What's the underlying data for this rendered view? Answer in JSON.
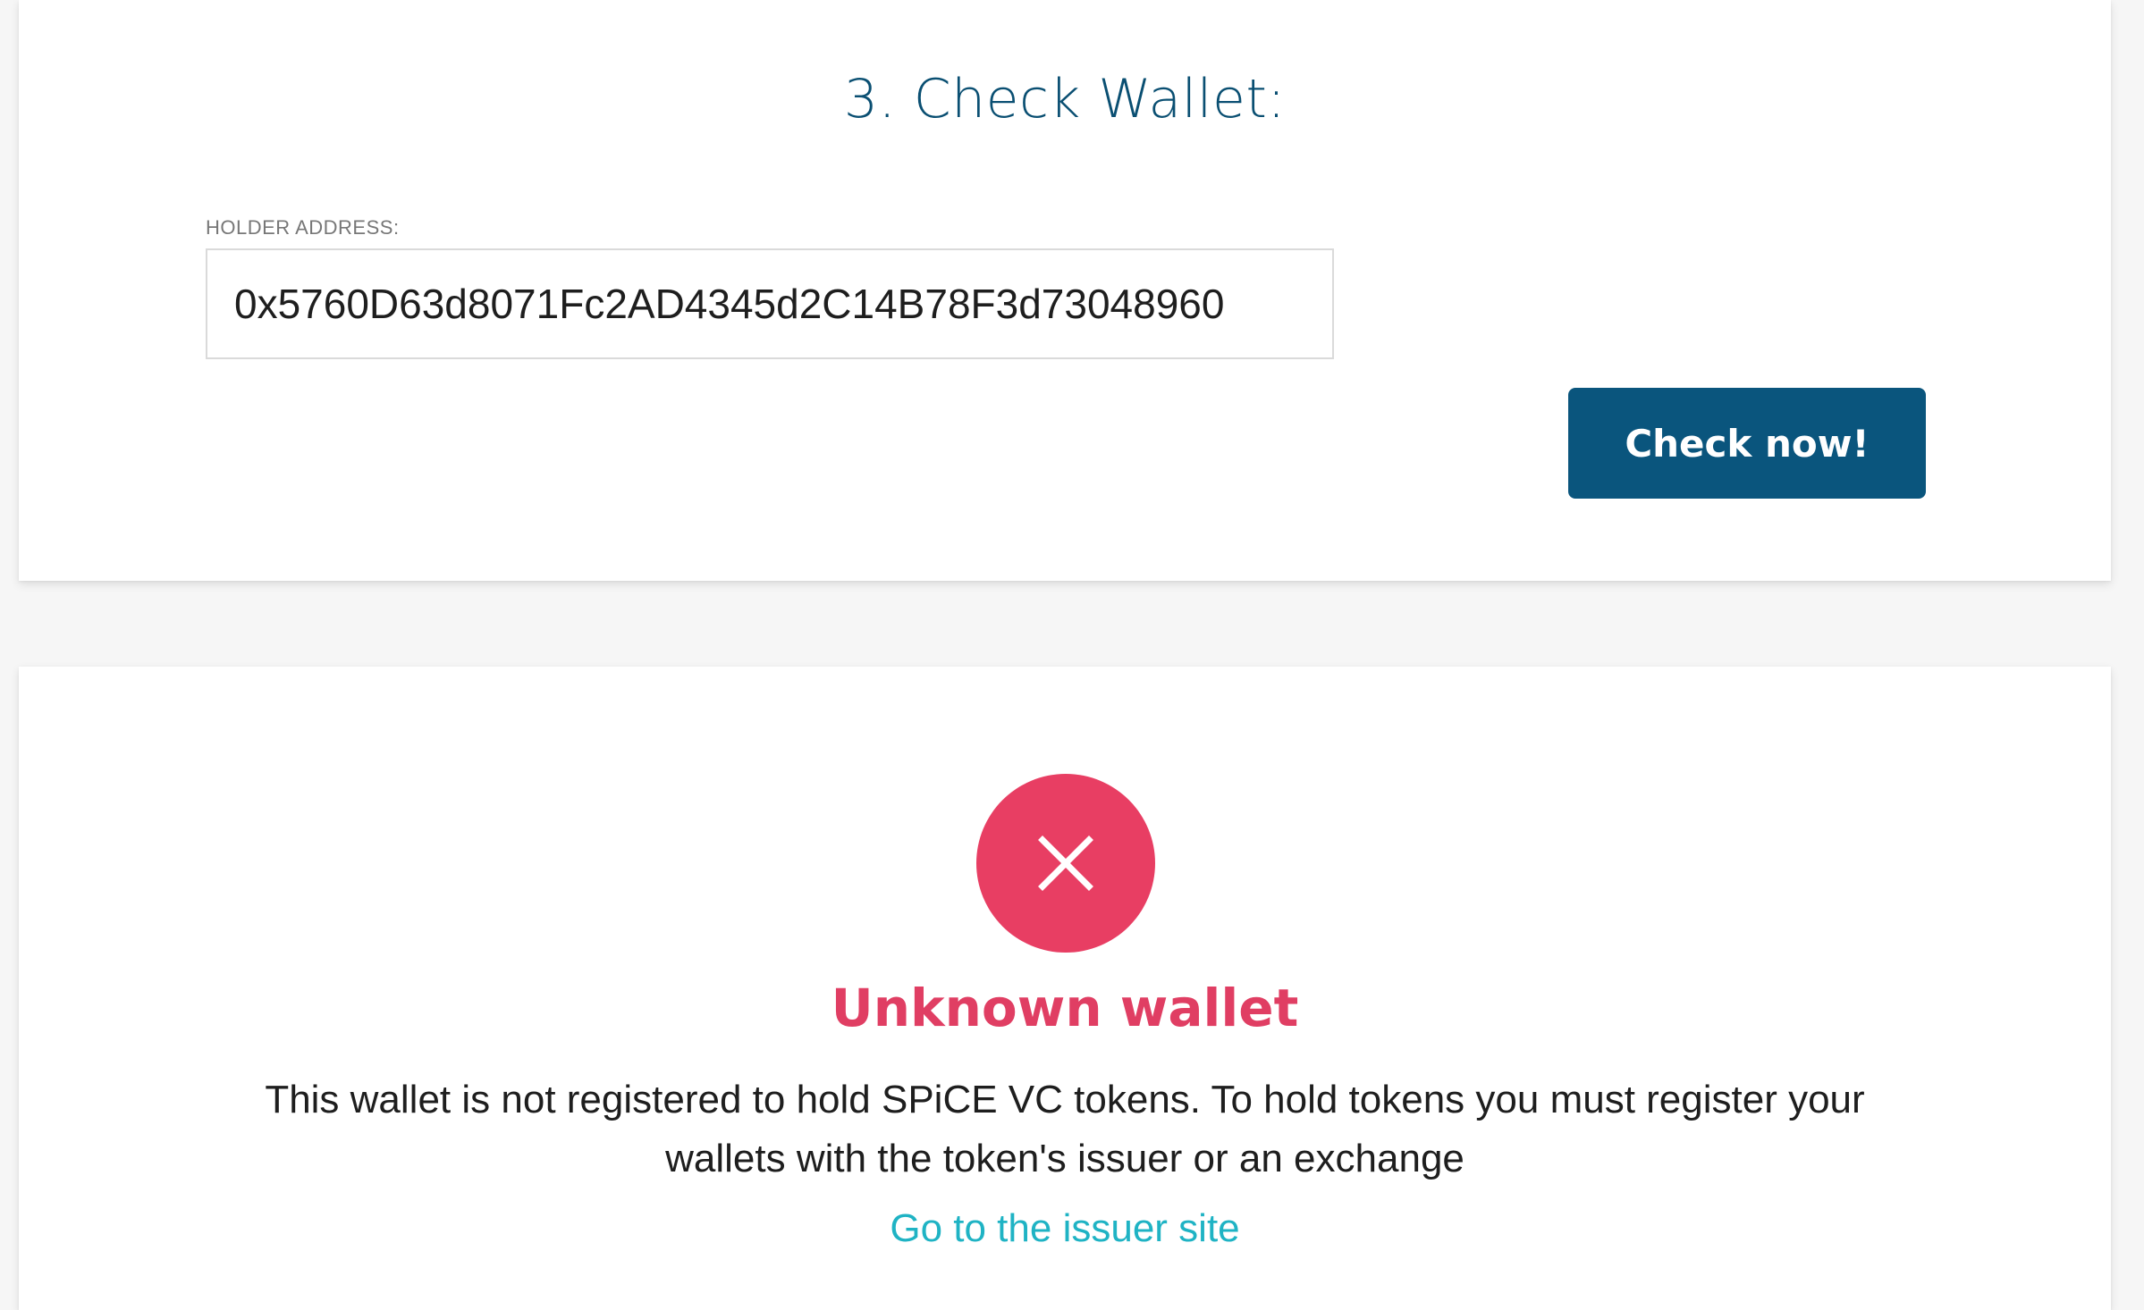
{
  "check_section": {
    "title": "3. Check Wallet:",
    "holder_label": "HOLDER ADDRESS:",
    "holder_address": "0x5760D63d8071Fc2AD4345d2C14B78F3d73048960",
    "check_button_label": "Check now!"
  },
  "result_section": {
    "status_icon": "close-icon",
    "status_title": "Unknown wallet",
    "message": "This wallet is not registered to hold SPiCE VC tokens. To hold tokens you must register your wallets with the token's issuer or an exchange",
    "link_label": "Go to the issuer site"
  },
  "colors": {
    "primary": "#0a557d",
    "error": "#e83e63",
    "link": "#1fb3c4"
  }
}
